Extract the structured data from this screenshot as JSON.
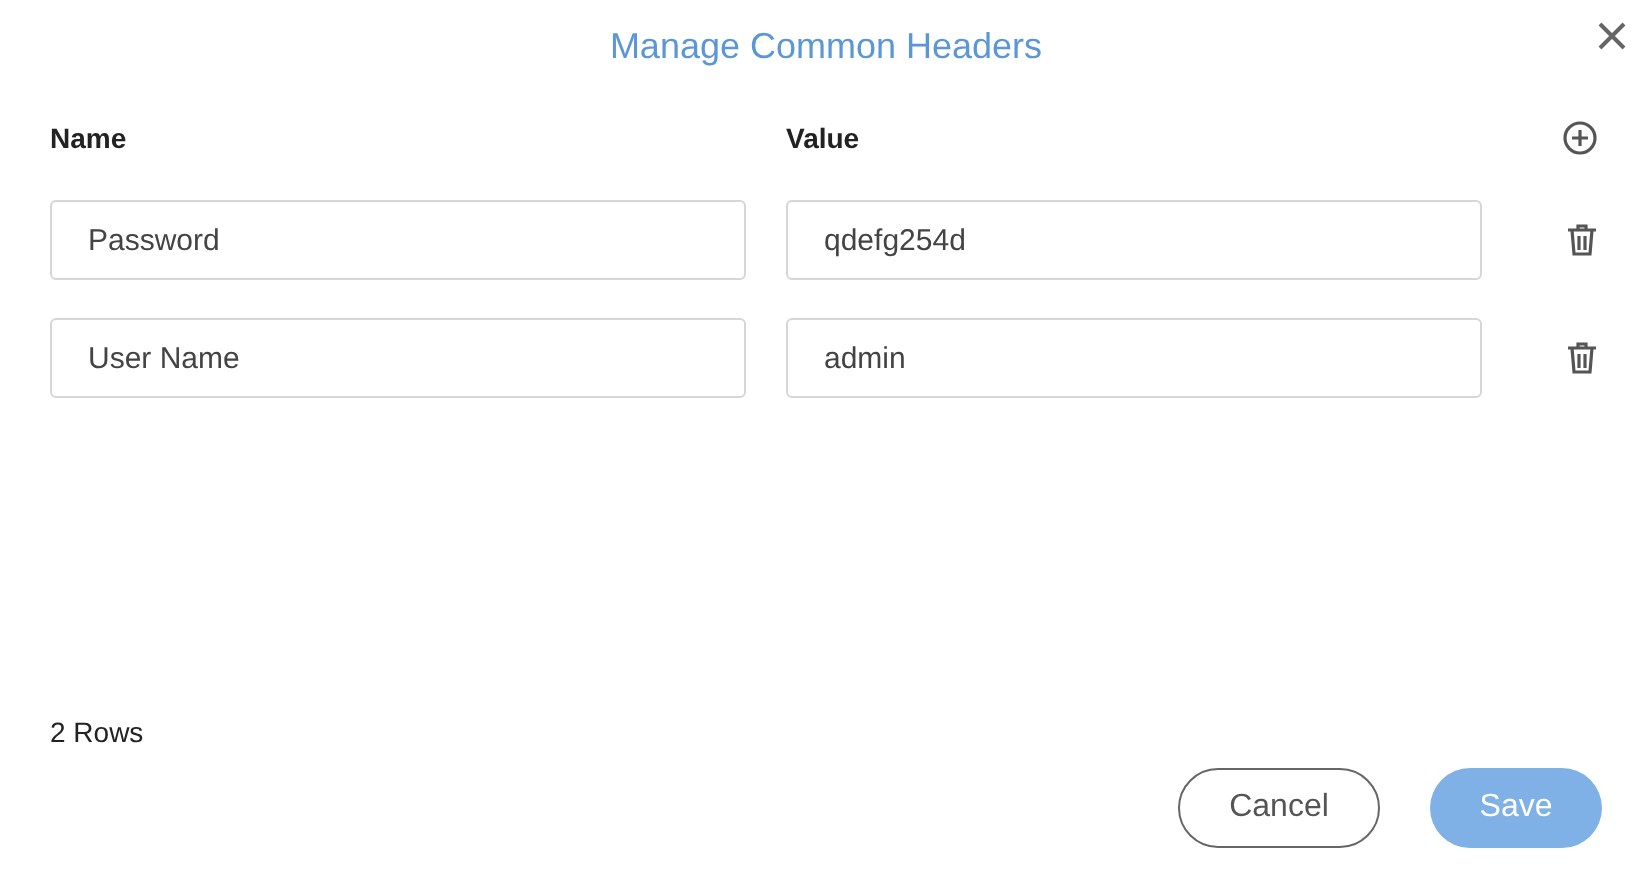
{
  "dialog": {
    "title": "Manage Common Headers"
  },
  "columns": [
    "Name",
    "Value"
  ],
  "rows": [
    {
      "name": "Password",
      "value": "qdefg254d"
    },
    {
      "name": "User Name",
      "value": "admin"
    }
  ],
  "row_count": "2 Rows",
  "buttons": [
    {
      "kind": "secondary",
      "label": "Cancel",
      "disabled": false
    },
    {
      "kind": "primary",
      "label": "Save",
      "disabled": true
    }
  ]
}
